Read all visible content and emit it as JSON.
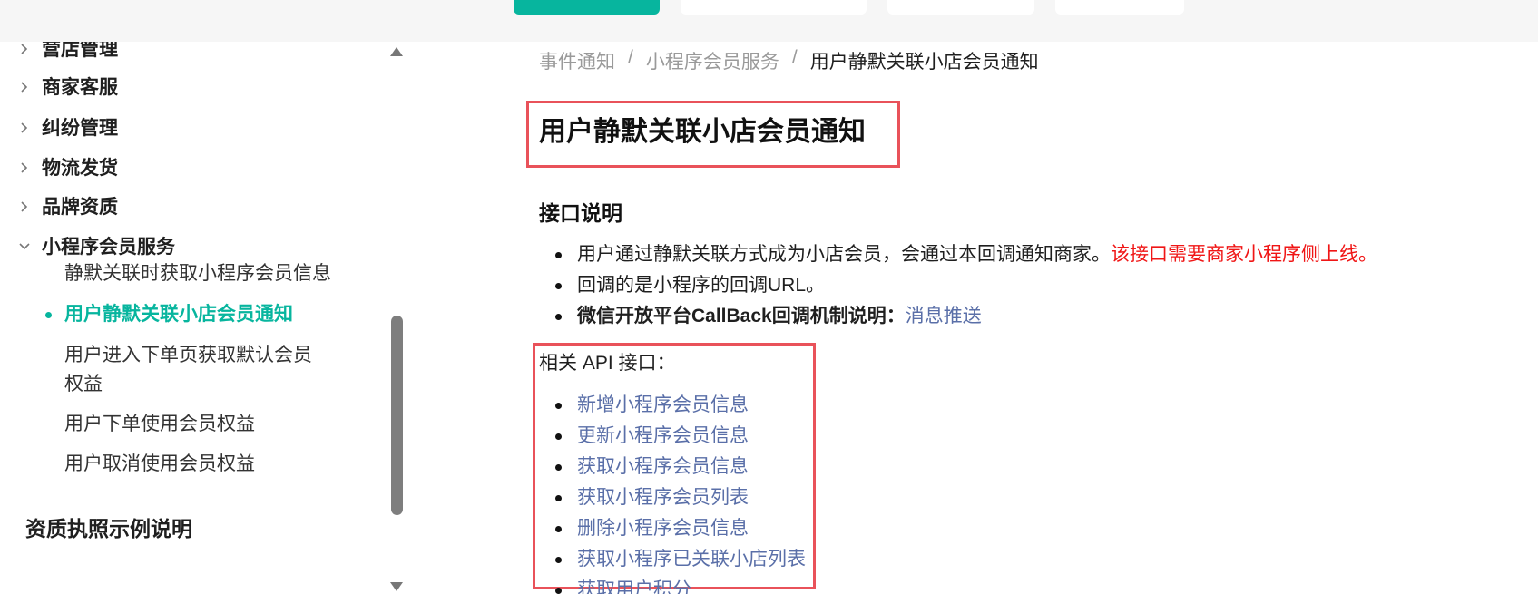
{
  "sidebar": {
    "items": [
      {
        "label": "营店管理",
        "expanded": false
      },
      {
        "label": "商家客服",
        "expanded": false
      },
      {
        "label": "纠纷管理",
        "expanded": false
      },
      {
        "label": "物流发货",
        "expanded": false
      },
      {
        "label": "品牌资质",
        "expanded": false
      },
      {
        "label": "小程序会员服务",
        "expanded": true
      }
    ],
    "sub_items": [
      {
        "label": "静默关联时获取小程序会员信息"
      },
      {
        "label": "用户静默关联小店会员通知",
        "active": true
      },
      {
        "label": "用户进入下单页获取默认会员权益"
      },
      {
        "label": "用户下单使用会员权益"
      },
      {
        "label": "用户取消使用会员权益"
      }
    ],
    "section": "资质执照示例说明"
  },
  "breadcrumb": [
    "事件通知",
    "小程序会员服务",
    "用户静默关联小店会员通知"
  ],
  "breadcrumb_sep": "/",
  "title": "用户静默关联小店会员通知",
  "section_heading": "接口说明",
  "description": {
    "line1_text": "用户通过静默关联方式成为小店会员，会通过本回调通知商家。",
    "line1_red": "该接口需要商家小程序侧上线。",
    "line2": "回调的是小程序的回调URL。",
    "line3_bold": "微信开放平台CallBack回调机制说明：",
    "line3_link": "消息推送"
  },
  "api_label": "相关 API 接口：",
  "api_links": [
    "新增小程序会员信息",
    "更新小程序会员信息",
    "获取小程序会员信息",
    "获取小程序会员列表",
    "删除小程序会员信息",
    "获取小程序已关联小店列表",
    "获取用户积分"
  ],
  "colors": {
    "accent": "#07b59e",
    "highlight": "#e9525a",
    "link": "#5a6fa8",
    "warning": "#f01616"
  }
}
